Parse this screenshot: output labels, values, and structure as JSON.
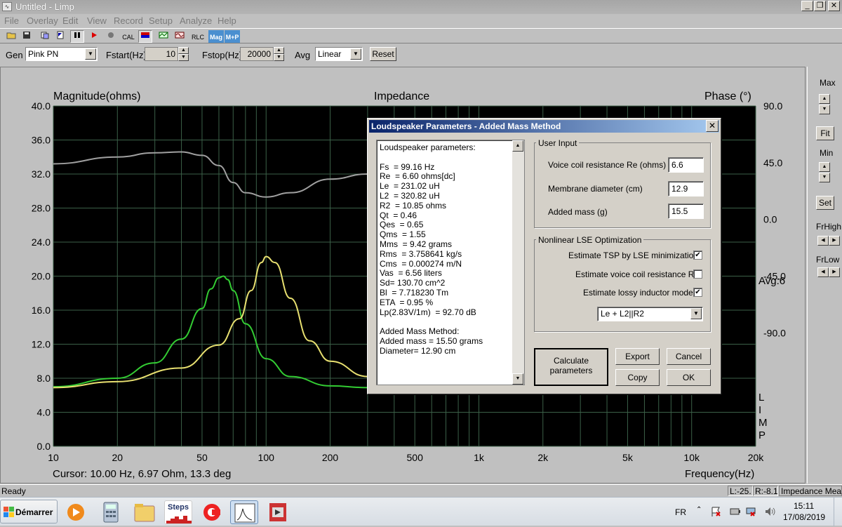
{
  "window": {
    "title": "Untitled - Limp"
  },
  "menu": [
    "File",
    "Overlay",
    "Edit",
    "View",
    "Record",
    "Setup",
    "Analyze",
    "Help"
  ],
  "toolbar": {
    "cal": "CAL",
    "rlc": "RLC",
    "mag": "Mag",
    "mp": "M+P"
  },
  "params": {
    "gen_label": "Gen",
    "gen_value": "Pink PN",
    "fstart_label": "Fstart(Hz)",
    "fstart_value": "10",
    "fstop_label": "Fstop(Hz)",
    "fstop_value": "20000",
    "avg_label": "Avg",
    "avg_value": "Linear",
    "reset_label": "Reset"
  },
  "plot": {
    "left_title": "Magnitude(ohms)",
    "center_title": "Impedance",
    "right_title": "Phase (°)",
    "left_ticks": [
      "40.0",
      "36.0",
      "32.0",
      "28.0",
      "24.0",
      "20.0",
      "16.0",
      "12.0",
      "8.0",
      "4.0",
      "0.0"
    ],
    "right_ticks": [
      "90.0",
      "45.0",
      "0.0",
      "-45.0",
      "-90.0"
    ],
    "x_ticks": [
      "10",
      "20",
      "50",
      "100",
      "200",
      "500",
      "1k",
      "2k",
      "5k",
      "10k",
      "20k"
    ],
    "x_title": "Frequency(Hz)",
    "cursor": "Cursor: 10.00 Hz, 6.97 Ohm, 13.3 deg",
    "avg_text": "Avg:6",
    "limp_letters": [
      "L",
      "I",
      "M",
      "P"
    ]
  },
  "chart_data": {
    "type": "line",
    "xlabel": "Frequency(Hz)",
    "ylabel": "Magnitude(ohms)",
    "y2label": "Phase (°)",
    "xscale": "log",
    "xlim": [
      10,
      20000
    ],
    "ylim": [
      0,
      40
    ],
    "y2lim": [
      -180,
      90
    ],
    "grid": true,
    "series": [
      {
        "color": "#33cc33",
        "x": [
          10,
          20,
          30,
          40,
          50,
          55,
          60,
          63,
          66,
          70,
          80,
          100,
          130,
          200,
          300,
          500
        ],
        "values": [
          7.0,
          8.0,
          9.8,
          12.6,
          16.2,
          18.5,
          19.8,
          20.0,
          19.6,
          18.3,
          14.4,
          10.3,
          8.2,
          7.1,
          6.9,
          6.8
        ]
      },
      {
        "color": "#e8e070",
        "x": [
          10,
          20,
          40,
          60,
          75,
          85,
          95,
          100,
          110,
          130,
          160,
          200,
          300,
          400,
          500
        ],
        "values": [
          6.9,
          7.6,
          9.2,
          11.9,
          15.0,
          18.3,
          21.6,
          22.3,
          21.6,
          17.4,
          12.4,
          10.0,
          8.2,
          7.6,
          7.3
        ]
      },
      {
        "color": "#a0a0a0",
        "x": [
          10,
          20,
          30,
          40,
          50,
          60,
          70,
          80,
          100,
          130,
          200,
          300,
          500
        ],
        "values": [
          33.2,
          34.0,
          34.5,
          34.6,
          34.2,
          33.0,
          31.0,
          29.8,
          29.3,
          29.8,
          31.4,
          32.0,
          32.4
        ]
      }
    ]
  },
  "rpanel": {
    "max": "Max",
    "fit": "Fit",
    "min": "Min",
    "set": "Set",
    "frhigh": "FrHigh",
    "frlow": "FrLow"
  },
  "status": {
    "ready": "Ready",
    "l": "L:-25.",
    "r": "R:-8.1",
    "mode": "Impedance Meas"
  },
  "taskbar": {
    "start": "Démarrer",
    "steps": "Steps",
    "lang": "FR",
    "time": "15:11",
    "date": "17/08/2019"
  },
  "dialog": {
    "title": "Loudspeaker Parameters - Added Mass Method",
    "results": "Loudspeaker parameters:\n\nFs  = 99.16 Hz\nRe  = 6.60 ohms[dc]\nLe  = 231.02 uH\nL2  = 320.82 uH\nR2  = 10.85 ohms\nQt  = 0.46\nQes  = 0.65\nQms  = 1.55\nMms  = 9.42 grams\nRms  = 3.758641 kg/s\nCms  = 0.000274 m/N\nVas  = 6.56 liters\nSd= 130.70 cm^2\nBl  = 7.718230 Tm\nETA  = 0.95 %\nLp(2.83V/1m)  = 92.70 dB\n\nAdded Mass Method:\nAdded mass = 15.50 grams\nDiameter= 12.90 cm",
    "user_input": {
      "title": "User Input",
      "re_label": "Voice coil resistance Re (ohms)",
      "re_value": "6.6",
      "diam_label": "Membrane diameter (cm)",
      "diam_value": "12.9",
      "mass_label": "Added mass (g)",
      "mass_value": "15.5"
    },
    "lse": {
      "title": "Nonlinear LSE Optimization",
      "tsp_label": "Estimate TSP by LSE minimization",
      "tsp_checked": true,
      "re_label": "Estimate voice coil resistance Re",
      "re_checked": false,
      "ind_label": "Estimate lossy inductor model",
      "ind_checked": true,
      "model_value": "Le + L2||R2"
    },
    "buttons": {
      "calc": "Calculate\nparameters",
      "export": "Export",
      "cancel": "Cancel",
      "copy": "Copy",
      "ok": "OK"
    }
  }
}
